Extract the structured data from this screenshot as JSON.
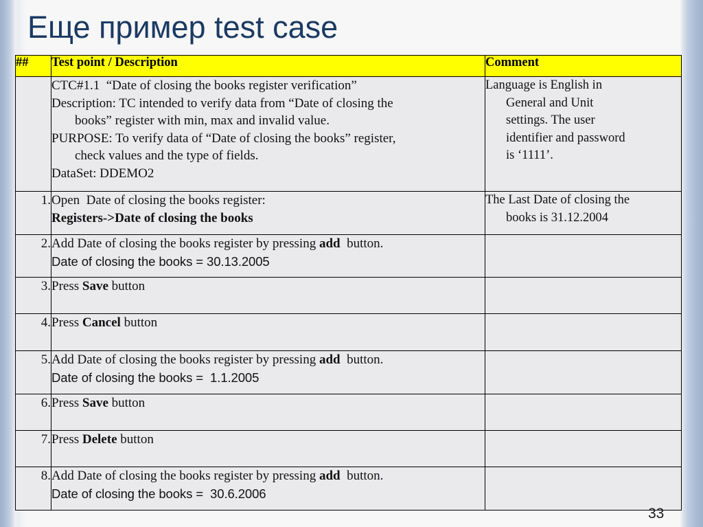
{
  "slide": {
    "title": "Еще пример test case",
    "page_number": "33",
    "title_color": "#1b3a63",
    "header_fill": "#ffff00",
    "cell_fill": "#eaeaec"
  },
  "table": {
    "headers": {
      "num": "##",
      "description": "Test point / Description",
      "comment": "Comment"
    },
    "rows": [
      {
        "num": "",
        "description_lines": [
          {
            "text": "CTC#1.1  “Date of closing the books register verification”",
            "style": "serif",
            "indent": false
          },
          {
            "text": "Description: TC intended to verify data from “Date of closing the",
            "style": "serif",
            "indent": false
          },
          {
            "text": "books” register with min, max and invalid value.",
            "style": "serif",
            "indent": true
          },
          {
            "text": "PURPOSE: To verify data of “Date of closing the books” register,",
            "style": "serif",
            "indent": false
          },
          {
            "text": "check values and the type of fields.",
            "style": "serif",
            "indent": true
          },
          {
            "text": "DataSet: DDEMO2",
            "style": "serif",
            "indent": false
          }
        ],
        "comment_lines": [
          {
            "text": "Language is English in",
            "indent": false
          },
          {
            "text": "General and Unit",
            "indent": true
          },
          {
            "text": "settings. The user",
            "indent": true
          },
          {
            "text": "identifier and password",
            "indent": true
          },
          {
            "text": "is ‘1111’.",
            "indent": true
          }
        ]
      },
      {
        "num": "1.",
        "description_lines": [
          {
            "text": "Open  Date of closing the books register:",
            "style": "serif",
            "indent": false
          },
          {
            "text": "Registers->Date of closing the books",
            "style": "serif-bold",
            "indent": false
          }
        ],
        "comment_lines": [
          {
            "text": "The Last Date of closing the",
            "indent": false
          },
          {
            "text": "books is 31.12.2004",
            "indent": true
          }
        ]
      },
      {
        "num": "2.",
        "description_lines": [
          {
            "text": "Add Date of closing the books register by pressing ",
            "style": "serif",
            "indent": false,
            "bold_tail": "add",
            "tail": "  button."
          },
          {
            "text": "Date of closing the books = 30.13.2005",
            "style": "sans",
            "indent": false
          }
        ],
        "comment_lines": []
      },
      {
        "num": "3.",
        "description_lines": [
          {
            "text": "Press ",
            "style": "serif",
            "indent": false,
            "bold_tail": "Save",
            "tail": " button"
          }
        ],
        "comment_lines": []
      },
      {
        "num": "4.",
        "description_lines": [
          {
            "text": "Press ",
            "style": "serif",
            "indent": false,
            "bold_tail": "Cancel",
            "tail": " button"
          }
        ],
        "comment_lines": []
      },
      {
        "num": "5.",
        "description_lines": [
          {
            "text": "Add Date of closing the books register by pressing ",
            "style": "serif",
            "indent": false,
            "bold_tail": "add",
            "tail": "  button."
          },
          {
            "text": "Date of closing the books =  1.1.2005",
            "style": "sans",
            "indent": false
          }
        ],
        "comment_lines": []
      },
      {
        "num": "6.",
        "description_lines": [
          {
            "text": "Press ",
            "style": "serif",
            "indent": false,
            "bold_tail": "Save",
            "tail": " button"
          }
        ],
        "comment_lines": []
      },
      {
        "num": "7.",
        "description_lines": [
          {
            "text": "Press ",
            "style": "serif",
            "indent": false,
            "bold_tail": "Delete",
            "tail": " button"
          }
        ],
        "comment_lines": []
      },
      {
        "num": "8.",
        "description_lines": [
          {
            "text": "Add Date of closing the books register by pressing ",
            "style": "serif",
            "indent": false,
            "bold_tail": "add",
            "tail": "  button."
          },
          {
            "text": "Date of closing the books =  30.6.2006",
            "style": "sans",
            "indent": false
          }
        ],
        "comment_lines": []
      }
    ]
  }
}
